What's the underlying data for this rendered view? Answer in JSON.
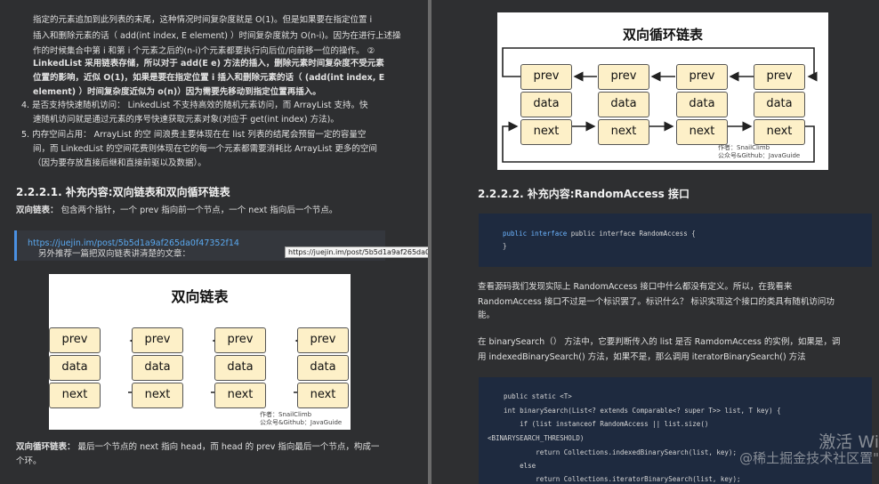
{
  "left": {
    "list_intro_lines": [
      "指定的元素追加到此列表的末尾，这种情况时间复杂度就是 O(1)。但是如果要在指定位置 i",
      "插入和删除元素的话（ add(int index, E element) ）时间复杂度就为 O(n-i)。因为在进行上述操",
      "作的时候集合中第 i 和第 i 个元素之后的(n-i)个元素都要执行向后位/向前移一位的操作。 ②",
      "LinkedList 采用链表存储，所以对于 add(E e) 方法的插入，删除元素时间复杂度不受元素",
      "位置的影响，近似 O(1)，如果是要在指定位置 i 插入和删除元素的话（ (add(int index, E",
      "element) ）时间复杂度近似为 o(n)）因为需要先移动到指定位置再插入。"
    ],
    "item4_lines": [
      "4.  是否支持快速随机访问：  LinkedList  不支持高效的随机元素访问，而  ArrayList  支持。快",
      "速随机访问就是通过元素的序号快速获取元素对象(对应于  get(int index)  方法)。"
    ],
    "item5_lines": [
      "5.  内存空间占用：  ArrayList 的空 间浪费主要体现在在 list 列表的结尾会预留一定的容量空",
      "间，而 LinkedList 的空间花费则体现在它的每一个元素都需要消耗比 ArrayList 更多的空间",
      "（因为要存放直接后继和直接前驱以及数据）。"
    ],
    "heading": "2.2.2.1. 补充内容:双向链表和双向循环链表",
    "double_list_label": "双向链表：",
    "double_list_text": "包含两个指针，一个 prev 指向前一个节点，一个 next 指向后一个节点。",
    "quote_text": "另外推荐一篇把双向链表讲清楚的文章：",
    "quote_link": "https://juejin.im/post/5b5d1a9af265da0f47352f14",
    "tooltip": "https://juejin.im/post/5b5d1a9af265da0f47352f14",
    "diagram_title": "双向链表",
    "cells": [
      "prev",
      "data",
      "next"
    ],
    "credit_line1": "作者：SnailClimb",
    "credit_line2": "公众号&Github：JavaGuide",
    "circular_label": "双向循环链表：",
    "circular_text_line1": "最后一个节点的 next 指向 head，而 head 的 prev 指向最后一个节点，构成一",
    "circular_text_line2": "个环。"
  },
  "right": {
    "diagram_title": "双向循环链表",
    "cells": [
      "prev",
      "data",
      "next"
    ],
    "credit_line1": "作者：SnailClimb",
    "credit_line2": "公众号&Github：JavaGuide",
    "heading": "2.2.2.2. 补充内容:RandomAccess 接口",
    "code1_line1": "public interface RandomAccess {",
    "code1_line2": "}",
    "para1_line1": "查看源码我们发现实际上  RandomAccess  接口中什么都没有定义。所以，在我看来",
    "para1_line2": "RandomAccess  接口不过是一个标识罢了。标识什么？ 标识实现这个接口的类具有随机访问功",
    "para1_line3": "能。",
    "para2_line1": "在  binarySearch（）  方法中，它要判断传入的 list 是否  RamdomAccess  的实例，如果是，调",
    "para2_line2": "用  indexedBinarySearch()  方法，如果不是，那么调用  iteratorBinarySearch()  方法",
    "code2": [
      "    public static <T>",
      "    int binarySearch(List<? extends Comparable<? super T>> list, T key) {",
      "        if (list instanceof RandomAccess || list.size()",
      "<BINARYSEARCH_THRESHOLD)",
      "            return Collections.indexedBinarySearch(list, key);",
      "        else",
      "            return Collections.iteratorBinarySearch(list, key);"
    ],
    "watermark1": "激活 Wi",
    "watermark2": "@稀土掘金技术社区置\""
  }
}
